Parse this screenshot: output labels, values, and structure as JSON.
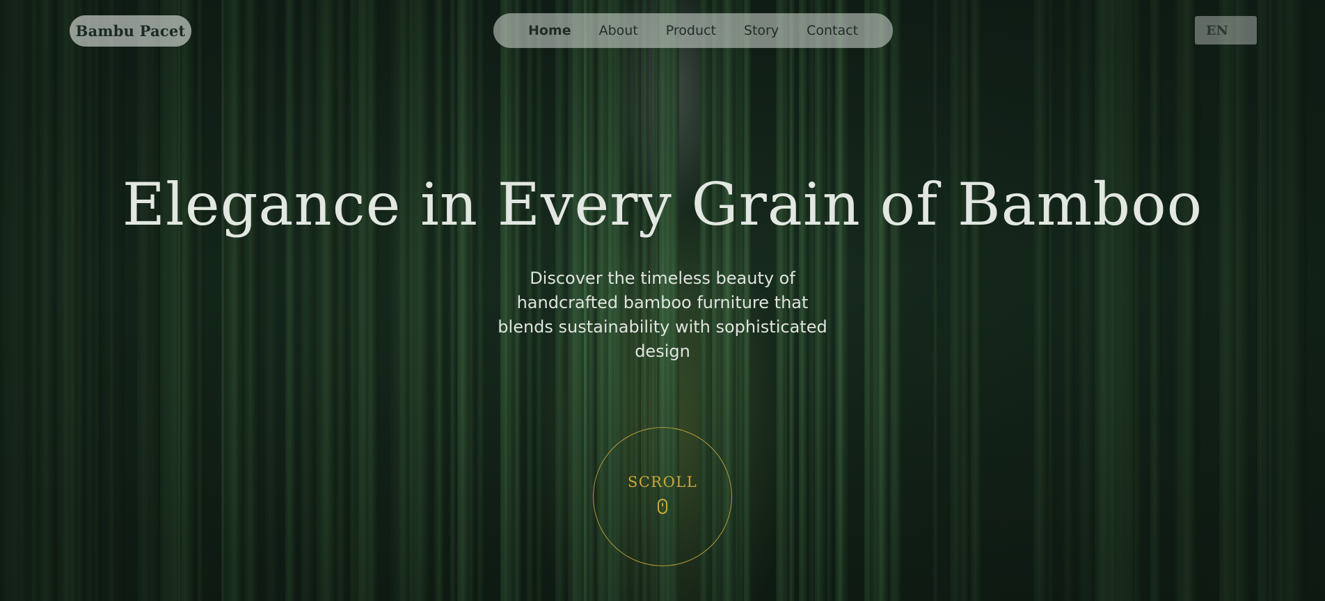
{
  "brand": {
    "name": "Bambu Pacet"
  },
  "nav": {
    "items": [
      {
        "label": "Home",
        "active": true
      },
      {
        "label": "About",
        "active": false
      },
      {
        "label": "Product",
        "active": false
      },
      {
        "label": "Story",
        "active": false
      },
      {
        "label": "Contact",
        "active": false
      }
    ]
  },
  "language": {
    "selected": "EN"
  },
  "hero": {
    "headline": "Elegance in Every Grain of Bamboo",
    "subtitle": "Discover the timeless beauty of handcrafted bamboo furniture that blends sustainability with sophisticated design",
    "background": "bamboo-forest-image"
  },
  "scroll": {
    "label": "SCROLL",
    "icon": "mouse-icon"
  },
  "colors": {
    "accent_gold": "#c9a93c",
    "pill_bg": "#e1e4e1",
    "text_light": "#e3e7e2",
    "text_dark": "#1f2d27"
  }
}
